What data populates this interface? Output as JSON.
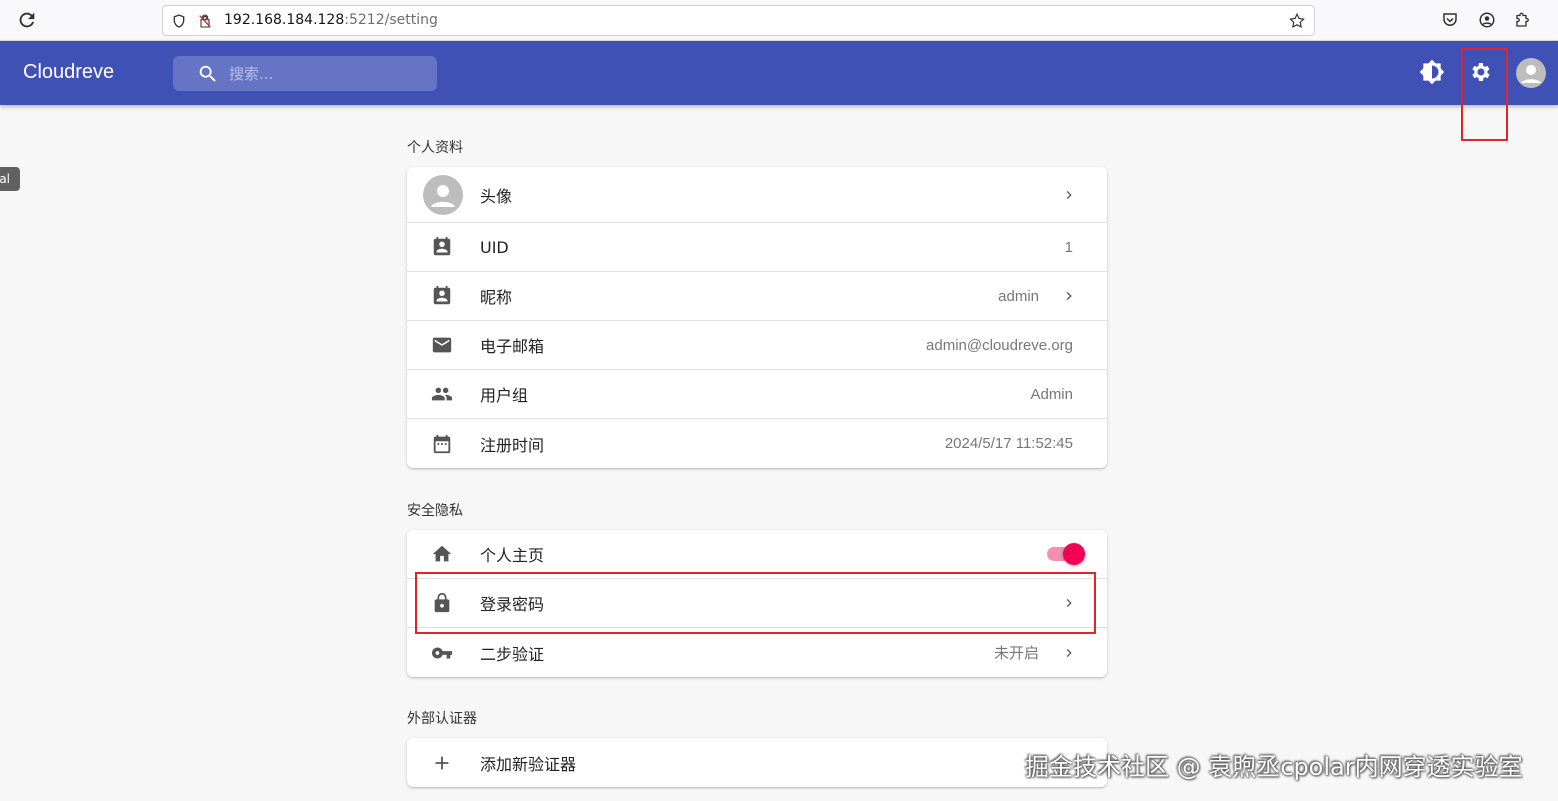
{
  "browser": {
    "url_host": "192.168.184.128",
    "url_path": ":5212/setting"
  },
  "appbar": {
    "brand": "Cloudreve",
    "search_placeholder": "搜索..."
  },
  "left_tag": "al",
  "sections": {
    "profile": {
      "title": "个人资料",
      "rows": {
        "avatar": {
          "label": "头像"
        },
        "uid": {
          "label": "UID",
          "value": "1"
        },
        "nickname": {
          "label": "昵称",
          "value": "admin"
        },
        "email": {
          "label": "电子邮箱",
          "value": "admin@cloudreve.org"
        },
        "group": {
          "label": "用户组",
          "value": "Admin"
        },
        "registered": {
          "label": "注册时间",
          "value": "2024/5/17 11:52:45"
        }
      }
    },
    "security": {
      "title": "安全隐私",
      "rows": {
        "homepage": {
          "label": "个人主页",
          "enabled": true
        },
        "password": {
          "label": "登录密码"
        },
        "twofa": {
          "label": "二步验证",
          "value": "未开启"
        }
      }
    },
    "authenticators": {
      "title": "外部认证器",
      "rows": {
        "add": {
          "label": "添加新验证器"
        }
      }
    }
  },
  "watermark": "掘金技术社区 @ 袁煦丞cpolar内网穿透实验室",
  "colors": {
    "primary": "#3f51b5",
    "accent": "#f50057",
    "highlight": "#e0242b"
  }
}
